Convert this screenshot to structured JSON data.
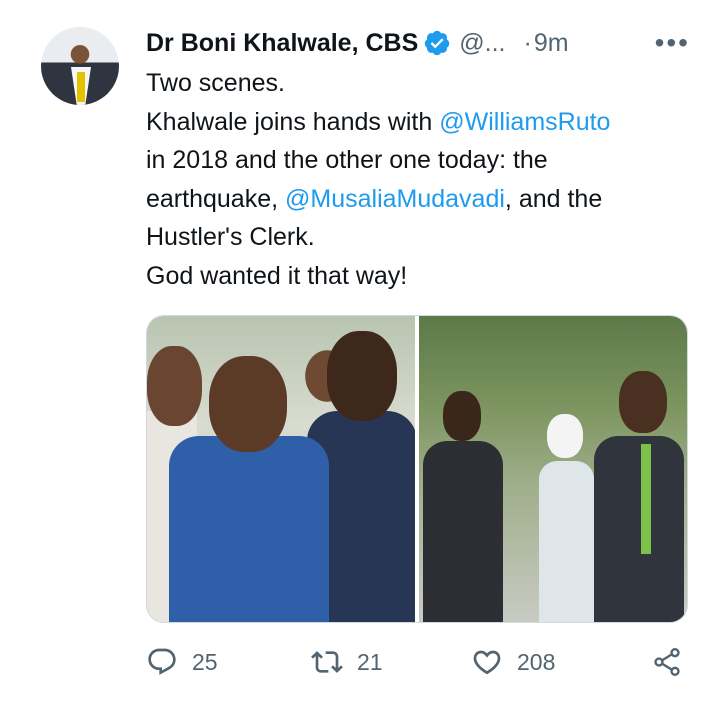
{
  "tweet": {
    "display_name": "Dr Boni Khalwale, CBS",
    "handle": "@...",
    "separator": "·",
    "time": "9m",
    "more_label": "•••",
    "text_lines": [
      "Two scenes.",
      "Khalwale joins hands with ",
      "@WilliamsRuto",
      "in 2018 and the other one today: the",
      "earthquake, ",
      "@MusaliaMudavadi",
      ", and the",
      "Hustler's Clerk.",
      "God wanted it that way!"
    ]
  },
  "actions": {
    "reply_count": "25",
    "retweet_count": "21",
    "like_count": "208"
  },
  "icons": {
    "verified": "verified-badge-icon",
    "more": "more-icon",
    "reply": "reply-icon",
    "retweet": "retweet-icon",
    "like": "heart-icon",
    "share": "share-icon"
  },
  "colors": {
    "accent": "#1d9bf0",
    "text": "#0f1419",
    "muted": "#536471",
    "border": "#cfd9de"
  }
}
